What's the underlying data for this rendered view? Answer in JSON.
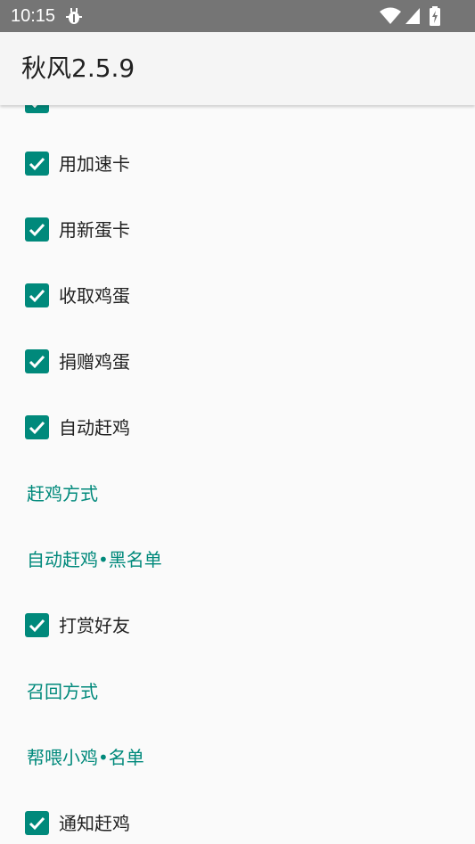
{
  "status_bar": {
    "time": "10:15",
    "icons": [
      "bug-icon",
      "wifi-icon",
      "signal-icon",
      "battery-charging-icon"
    ]
  },
  "app_bar": {
    "title": "秋风2.5.9"
  },
  "settings": {
    "accent_color": "#00897b",
    "items": [
      {
        "type": "checkbox",
        "label": "",
        "checked": true
      },
      {
        "type": "checkbox",
        "label": "用加速卡",
        "checked": true
      },
      {
        "type": "checkbox",
        "label": "用新蛋卡",
        "checked": true
      },
      {
        "type": "checkbox",
        "label": "收取鸡蛋",
        "checked": true
      },
      {
        "type": "checkbox",
        "label": "捐赠鸡蛋",
        "checked": true
      },
      {
        "type": "checkbox",
        "label": "自动赶鸡",
        "checked": true
      },
      {
        "type": "link",
        "label": "赶鸡方式"
      },
      {
        "type": "link",
        "label": "自动赶鸡•黑名单"
      },
      {
        "type": "checkbox",
        "label": "打赏好友",
        "checked": true
      },
      {
        "type": "link",
        "label": "召回方式"
      },
      {
        "type": "link",
        "label": "帮喂小鸡•名单"
      },
      {
        "type": "checkbox",
        "label": "通知赶鸡",
        "checked": true
      }
    ]
  }
}
